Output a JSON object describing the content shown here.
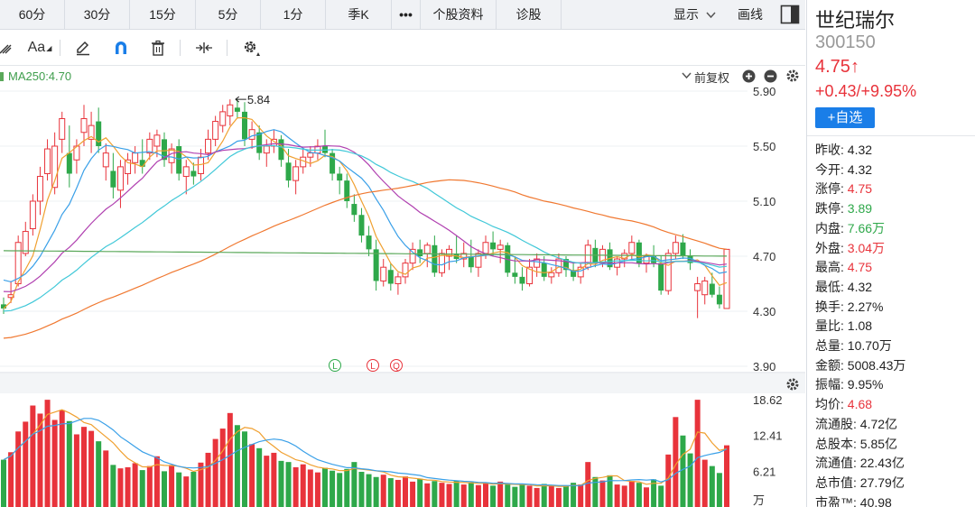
{
  "period_tabs": [
    "60分",
    "30分",
    "15分",
    "5分",
    "1分",
    "季K",
    "•••",
    "个股资料",
    "诊股"
  ],
  "top_right": {
    "display_label": "显示",
    "draw_label": "画线"
  },
  "price_header": {
    "ma_label": "MA250:4.70",
    "adjust_label": "前复权"
  },
  "price_axis": [
    "5.90",
    "5.50",
    "5.10",
    "4.70",
    "4.30",
    "3.90"
  ],
  "max_marker": "5.84",
  "signal_markers": [
    "L",
    "L",
    "Q"
  ],
  "volume_axis": [
    "18.62",
    "12.41",
    "6.21",
    "万"
  ],
  "stock": {
    "name": "世纪瑞尔",
    "code": "300150",
    "price": "4.75",
    "arrow": "↑",
    "change": "+0.43/+9.95%",
    "watch_label": "+自选"
  },
  "stats": [
    {
      "label": "昨收:",
      "value": "4.32",
      "tone": "neutral"
    },
    {
      "label": "今开:",
      "value": "4.32",
      "tone": "neutral"
    },
    {
      "label": "涨停:",
      "value": "4.75",
      "tone": "up"
    },
    {
      "label": "跌停:",
      "value": "3.89",
      "tone": "down"
    },
    {
      "label": "内盘:",
      "value": "7.66万",
      "tone": "down"
    },
    {
      "label": "外盘:",
      "value": "3.04万",
      "tone": "up"
    },
    {
      "label": "最高:",
      "value": "4.75",
      "tone": "up"
    },
    {
      "label": "最低:",
      "value": "4.32",
      "tone": "neutral"
    },
    {
      "label": "换手:",
      "value": "2.27%",
      "tone": "neutral"
    },
    {
      "label": "量比:",
      "value": "1.08",
      "tone": "neutral"
    },
    {
      "label": "总量:",
      "value": "10.70万",
      "tone": "neutral"
    },
    {
      "label": "金额:",
      "value": "5008.43万",
      "tone": "neutral"
    },
    {
      "label": "振幅:",
      "value": "9.95%",
      "tone": "neutral"
    },
    {
      "label": "均价:",
      "value": "4.68",
      "tone": "up"
    },
    {
      "label": "流通股:",
      "value": "4.72亿",
      "tone": "neutral"
    },
    {
      "label": "总股本:",
      "value": "5.85亿",
      "tone": "neutral"
    },
    {
      "label": "流通值:",
      "value": "22.43亿",
      "tone": "neutral"
    },
    {
      "label": "总市值:",
      "value": "27.79亿",
      "tone": "neutral"
    },
    {
      "label": "市盈™:",
      "value": "40.98",
      "tone": "neutral"
    }
  ],
  "colors": {
    "up": "#e8333b",
    "down": "#2ea84a",
    "accent": "#1a7ee8",
    "ma5": "#f0a030",
    "ma10": "#3aa0e8",
    "ma20": "#b040b0",
    "ma30": "#40c8d8",
    "ma60": "#f07830",
    "ma250": "#5aa85a"
  },
  "chart_data": {
    "type": "candlestick",
    "price_range": [
      3.9,
      5.9
    ],
    "volume_range": [
      0,
      18.62
    ],
    "volume_unit": "万",
    "candles": [
      [
        4.35,
        4.4,
        4.28,
        4.32
      ],
      [
        4.4,
        4.52,
        4.36,
        4.42
      ],
      [
        4.5,
        4.85,
        4.48,
        4.8
      ],
      [
        4.72,
        4.95,
        4.7,
        4.88
      ],
      [
        4.9,
        5.15,
        4.85,
        5.1
      ],
      [
        5.1,
        5.35,
        5.0,
        5.28
      ],
      [
        5.3,
        5.55,
        5.25,
        5.48
      ],
      [
        5.2,
        5.6,
        5.15,
        5.5
      ],
      [
        5.55,
        5.75,
        5.45,
        5.7
      ],
      [
        5.45,
        5.65,
        5.2,
        5.3
      ],
      [
        5.4,
        5.55,
        5.3,
        5.5
      ],
      [
        5.6,
        5.8,
        5.5,
        5.7
      ],
      [
        5.55,
        5.75,
        5.45,
        5.65
      ],
      [
        5.68,
        5.78,
        5.45,
        5.5
      ],
      [
        5.35,
        5.52,
        5.25,
        5.45
      ],
      [
        5.32,
        5.45,
        5.12,
        5.2
      ],
      [
        5.18,
        5.4,
        5.05,
        5.35
      ],
      [
        5.3,
        5.45,
        5.22,
        5.4
      ],
      [
        5.38,
        5.5,
        5.3,
        5.45
      ],
      [
        5.4,
        5.55,
        5.3,
        5.35
      ],
      [
        5.45,
        5.6,
        5.4,
        5.55
      ],
      [
        5.5,
        5.62,
        5.42,
        5.58
      ],
      [
        5.55,
        5.6,
        5.35,
        5.4
      ],
      [
        5.38,
        5.52,
        5.3,
        5.48
      ],
      [
        5.5,
        5.55,
        5.25,
        5.3
      ],
      [
        5.28,
        5.4,
        5.15,
        5.35
      ],
      [
        5.32,
        5.38,
        5.22,
        5.28
      ],
      [
        5.3,
        5.48,
        5.25,
        5.42
      ],
      [
        5.45,
        5.62,
        5.4,
        5.55
      ],
      [
        5.55,
        5.72,
        5.5,
        5.68
      ],
      [
        5.65,
        5.8,
        5.6,
        5.75
      ],
      [
        5.72,
        5.84,
        5.65,
        5.8
      ],
      [
        5.78,
        5.84,
        5.7,
        5.75
      ],
      [
        5.75,
        5.82,
        5.5,
        5.55
      ],
      [
        5.55,
        5.68,
        5.48,
        5.62
      ],
      [
        5.6,
        5.65,
        5.4,
        5.45
      ],
      [
        5.45,
        5.55,
        5.35,
        5.5
      ],
      [
        5.5,
        5.62,
        5.45,
        5.55
      ],
      [
        5.55,
        5.58,
        5.35,
        5.4
      ],
      [
        5.38,
        5.48,
        5.2,
        5.25
      ],
      [
        5.25,
        5.4,
        5.15,
        5.35
      ],
      [
        5.35,
        5.48,
        5.3,
        5.42
      ],
      [
        5.42,
        5.5,
        5.35,
        5.45
      ],
      [
        5.45,
        5.55,
        5.4,
        5.5
      ],
      [
        5.5,
        5.62,
        5.42,
        5.45
      ],
      [
        5.45,
        5.48,
        5.25,
        5.3
      ],
      [
        5.3,
        5.35,
        5.15,
        5.25
      ],
      [
        5.25,
        5.3,
        5.05,
        5.1
      ],
      [
        5.08,
        5.15,
        4.95,
        5.0
      ],
      [
        5.0,
        5.05,
        4.8,
        4.85
      ],
      [
        4.85,
        4.92,
        4.7,
        4.75
      ],
      [
        4.75,
        4.82,
        4.45,
        4.52
      ],
      [
        4.52,
        4.68,
        4.48,
        4.62
      ],
      [
        4.6,
        4.65,
        4.45,
        4.5
      ],
      [
        4.5,
        4.58,
        4.42,
        4.55
      ],
      [
        4.55,
        4.68,
        4.5,
        4.65
      ],
      [
        4.65,
        4.8,
        4.6,
        4.75
      ],
      [
        4.75,
        4.82,
        4.65,
        4.7
      ],
      [
        4.72,
        4.8,
        4.62,
        4.78
      ],
      [
        4.78,
        4.85,
        4.55,
        4.58
      ],
      [
        4.58,
        4.75,
        4.55,
        4.72
      ],
      [
        4.7,
        4.78,
        4.6,
        4.75
      ],
      [
        4.72,
        4.85,
        4.65,
        4.68
      ],
      [
        4.68,
        4.8,
        4.62,
        4.72
      ],
      [
        4.7,
        4.82,
        4.58,
        4.62
      ],
      [
        4.62,
        4.75,
        4.55,
        4.72
      ],
      [
        4.72,
        4.85,
        4.68,
        4.8
      ],
      [
        4.8,
        4.88,
        4.7,
        4.75
      ],
      [
        4.75,
        4.82,
        4.65,
        4.78
      ],
      [
        4.78,
        4.8,
        4.55,
        4.58
      ],
      [
        4.58,
        4.7,
        4.5,
        4.55
      ],
      [
        4.55,
        4.62,
        4.45,
        4.5
      ],
      [
        4.5,
        4.68,
        4.48,
        4.62
      ],
      [
        4.62,
        4.72,
        4.55,
        4.68
      ],
      [
        4.65,
        4.7,
        4.52,
        4.55
      ],
      [
        4.55,
        4.62,
        4.5,
        4.58
      ],
      [
        4.58,
        4.72,
        4.55,
        4.68
      ],
      [
        4.68,
        4.7,
        4.55,
        4.6
      ],
      [
        4.6,
        4.66,
        4.52,
        4.55
      ],
      [
        4.55,
        4.65,
        4.5,
        4.62
      ],
      [
        4.62,
        4.82,
        4.6,
        4.78
      ],
      [
        4.76,
        4.82,
        4.62,
        4.65
      ],
      [
        4.65,
        4.78,
        4.62,
        4.75
      ],
      [
        4.75,
        4.8,
        4.6,
        4.62
      ],
      [
        4.62,
        4.7,
        4.56,
        4.68
      ],
      [
        4.68,
        4.75,
        4.62,
        4.72
      ],
      [
        4.72,
        4.85,
        4.68,
        4.8
      ],
      [
        4.8,
        4.82,
        4.62,
        4.65
      ],
      [
        4.65,
        4.72,
        4.58,
        4.7
      ],
      [
        4.7,
        4.78,
        4.62,
        4.65
      ],
      [
        4.65,
        4.7,
        4.42,
        4.45
      ],
      [
        4.45,
        4.75,
        4.42,
        4.72
      ],
      [
        4.72,
        4.85,
        4.68,
        4.8
      ],
      [
        4.8,
        4.86,
        4.68,
        4.7
      ],
      [
        4.7,
        4.75,
        4.6,
        4.65
      ],
      [
        4.45,
        4.55,
        4.25,
        4.5
      ],
      [
        4.42,
        4.55,
        4.35,
        4.52
      ],
      [
        4.5,
        4.58,
        4.4,
        4.42
      ],
      [
        4.42,
        4.48,
        4.32,
        4.35
      ],
      [
        4.32,
        4.75,
        4.32,
        4.75
      ]
    ],
    "volumes": [
      8.2,
      9.5,
      13.1,
      14.8,
      17.6,
      16.2,
      18.6,
      15.1,
      16.8,
      14.9,
      12.6,
      13.9,
      13.2,
      11.4,
      9.8,
      7.3,
      6.7,
      6.9,
      7.6,
      6.4,
      7.1,
      8.8,
      6.2,
      7.3,
      6.0,
      5.3,
      6.1,
      7.7,
      9.4,
      11.8,
      13.6,
      16.3,
      14.2,
      13.1,
      10.9,
      10.2,
      8.9,
      9.4,
      8.0,
      7.8,
      6.9,
      7.4,
      6.5,
      6.0,
      6.8,
      6.3,
      5.9,
      6.6,
      7.8,
      6.1,
      5.7,
      5.2,
      5.6,
      5.0,
      4.7,
      5.3,
      4.4,
      4.9,
      4.1,
      4.5,
      4.2,
      4.0,
      4.6,
      3.9,
      4.3,
      3.8,
      4.1,
      3.7,
      4.4,
      3.9,
      3.5,
      3.9,
      3.7,
      3.3,
      4.0,
      3.6,
      3.3,
      3.7,
      4.2,
      3.9,
      7.8,
      5.2,
      4.6,
      5.5,
      3.9,
      3.7,
      4.5,
      4.2,
      3.4,
      4.8,
      3.7,
      9.1,
      15.6,
      12.4,
      9.3,
      18.6,
      8.2,
      7.1,
      5.9,
      10.7
    ],
    "ma_labels": [
      "MA250:4.70"
    ]
  }
}
